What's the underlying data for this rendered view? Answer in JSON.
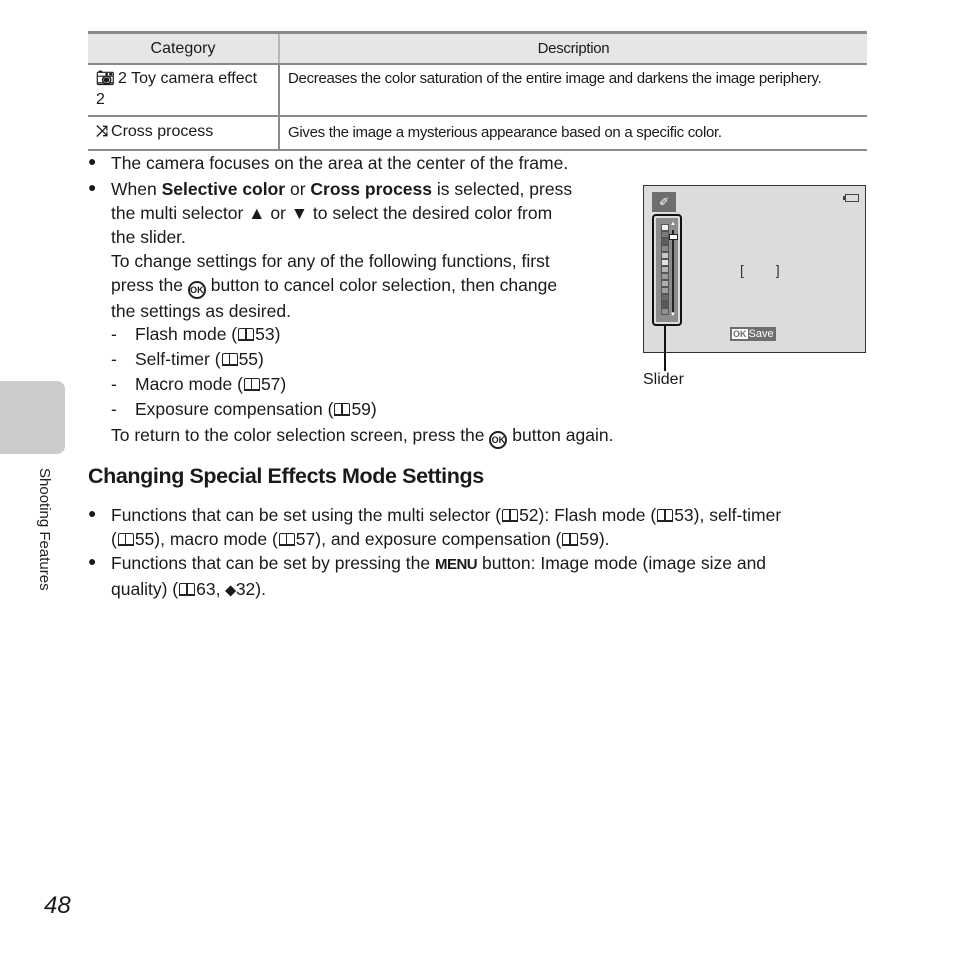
{
  "table": {
    "headers": [
      "Category",
      "Description"
    ],
    "rows": [
      {
        "icon": "toy-camera-2-icon",
        "icon_glyph": "⚇",
        "category": "2 Toy camera effect 2",
        "description": "Decreases the color saturation of the entire image and darkens the image periphery."
      },
      {
        "icon": "cross-process-icon",
        "icon_glyph": "⤨",
        "category": "Cross process",
        "description": "Gives the image a mysterious appearance based on a specific color."
      }
    ]
  },
  "bullets_top": [
    {
      "text": "The camera focuses on the area at the center of the frame."
    },
    {
      "parts": {
        "a": "When ",
        "b1": "Selective color",
        "c": " or ",
        "b2": "Cross process",
        "d": " is selected, press",
        "line2": "the multi selector ▲ or ▼ to select the desired color from",
        "line3": "the slider.",
        "line4": "To change settings for any of the following functions, first",
        "line5a": "press the ",
        "line5b": " button to cancel color selection, then change",
        "line6": "the settings as desired."
      }
    }
  ],
  "sub_items": [
    {
      "label": "Flash mode (",
      "page": "53)"
    },
    {
      "label": "Self-timer (",
      "page": "55)"
    },
    {
      "label": "Macro mode (",
      "page": "57)"
    },
    {
      "label": "Exposure compensation (",
      "page": "59)"
    }
  ],
  "return_line": {
    "a": "To return to the color selection screen, press the ",
    "b": " button again."
  },
  "ok_glyph": "OK",
  "section": {
    "title": "Changing Special Effects Mode Settings",
    "bullet1": {
      "a": "Functions that can be set using the multi selector (",
      "p1": "52): Flash mode (",
      "p2": "53), self-timer",
      "b": "(",
      "p3": "55), macro mode (",
      "p4": "57), and exposure compensation (",
      "p5": "59)."
    },
    "bullet2": {
      "a": "Functions that can be set by pressing the ",
      "menu": "MENU",
      "b": " button: Image mode (image size and",
      "c": "quality) (",
      "p1": "63, ",
      "glass": "⚇⚇",
      "p2": "32)."
    }
  },
  "camera_screen": {
    "save_ok": "OK",
    "save_label": "Save",
    "eyedropper_glyph": "✐",
    "focus_brackets": "[ ]",
    "slider_position": 0.05,
    "swatch_colors": [
      "#f0f0f0",
      "#7a7a7a",
      "#5e5e5e",
      "#8a8a8a",
      "#c8c8c8",
      "#e4e4e4",
      "#b4b4b4",
      "#9c9c9c",
      "#b0b0b0",
      "#a0a0a0",
      "#6a6a6a",
      "#5a5a5a",
      "#909090"
    ]
  },
  "slider_label": "Slider",
  "side_tab_label": "Shooting Features",
  "page_number": "48"
}
